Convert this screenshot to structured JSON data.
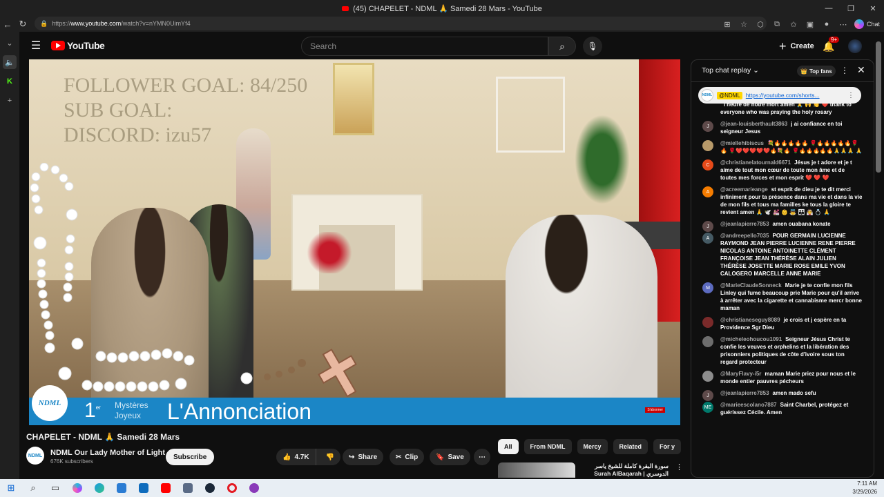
{
  "window": {
    "title": "(45) CHAPELET - NDML 🙏 Samedi 28 Mars - YouTube",
    "controls": [
      "—",
      "❐",
      "✕"
    ]
  },
  "browser": {
    "url_prefix": "https://",
    "url_host": "www.youtube.com",
    "url_path": "/watch?v=nYMN0UimYf4",
    "copilot_label": "Chat"
  },
  "header": {
    "search_placeholder": "Search",
    "create_label": "Create",
    "notif_count": "9+",
    "logo_text": "YouTube"
  },
  "video": {
    "overlay_lines": [
      "FOLLOWER GOAL:  84/250",
      "SUB GOAL:",
      "DISCORD: izu57"
    ],
    "logo": "NDML",
    "mystery_number": "1",
    "mystery_sup": "er",
    "mystery_label_1": "Mystères",
    "mystery_label_2": "Joyeux",
    "mystery_title": "L'Annonciation",
    "subscribe_tag": "S'abonner"
  },
  "below_video": {
    "title": "CHAPELET - NDML 🙏 Samedi 28 Mars",
    "channel_name": "NDML Our Lady Mother of Light",
    "channel_subs": "676K subscribers",
    "subscribe_label": "Subscribe",
    "channel_avatar": "NDML",
    "like_count": "4.7K",
    "share_label": "Share",
    "clip_label": "Clip",
    "save_label": "Save"
  },
  "chips": [
    "All",
    "From NDML",
    "Mercy",
    "Related",
    "For y"
  ],
  "recommendation": {
    "title": "سورة البقرة كاملة للشيخ ياسر الدوسري | Surah AlBaqarah"
  },
  "chat": {
    "header_title": "Top chat replay",
    "top_fans_label": "Top fans",
    "pinned": {
      "badge": "@NDML",
      "link": "https://youtube.com/shorts..."
    },
    "messages": [
      {
        "author": "",
        "text": "l'heure de notre mort amen 🙏 🙌 👏 ❤️ thank to everyone who was praying the holy rosary",
        "initial": "",
        "color": "#0f0f0f"
      },
      {
        "author": "@jean-louisberthault3863",
        "text": "j ai confiance en toi seigneur Jesus",
        "initial": "J",
        "color": "#5e4a4a"
      },
      {
        "author": "@miellehibiscus",
        "text": "💐🔥🔥🔥🔥🔥 🌹🔥🔥🔥🔥🔥🌹🔥 🌹❤️❤️❤️❤️❤️🔥💐🔥 🌹🔥🔥🔥🔥🔥🙏🙏🙏 🙏",
        "initial": "",
        "color": "#b89a6a"
      },
      {
        "author": "@christianelatournald6671",
        "text": "Jésus je t adore et je t aime de tout mon cœur de toute mon âme et de toutes mes forces et mon esprit ❤️ ❤️ ❤️",
        "initial": "C",
        "color": "#e64a19"
      },
      {
        "author": "@acreemarieange",
        "text": "st esprit de dieu je te dit merci infiniment pour ta présence dans ma vie et dans la vie de mon fils et tous ma familles ke tous la gloire te revient amen 🙏 🕊️ 💒 👶 👼 👪 👰 💍 🙏",
        "initial": "A",
        "color": "#f57c00"
      },
      {
        "author": "@jeanlapierre7853",
        "text": "amen ouabana konate",
        "initial": "J",
        "color": "#5e4a4a"
      },
      {
        "author": "@andreepello7035",
        "text": "POUR GERMAIN LUCIENNE RAYMOND JEAN PIERRE LUCIENNE RENE PIERRE NICOLAS ANTOINE ANTOINETTE CLÉMENT FRANÇOISE JEAN THÉRÈSE ALAIN JULIEN THÉRÈSE JOSETTE MARIE ROSE EMILE YVON CALOGERO MARCELLE ANNE MARIE",
        "initial": "A",
        "color": "#455a64"
      },
      {
        "author": "@MarieClaudeSonneck",
        "text": "Marie je te confie mon fils Linley qui fume beaucoup prie Marie pour qu'il arrive à arrêter avec la cigarette et cannabisme mercr bonne maman",
        "initial": "M",
        "color": "#5c6bc0"
      },
      {
        "author": "@christianeseguy8089",
        "text": "je crois et j espère en ta Providence Sgr Dieu",
        "initial": "",
        "color": "#7a2a2a"
      },
      {
        "author": "@micheleohoucou1091",
        "text": "Seigneur Jésus Christ te confie les veuves et orphelins et la libération des prisonniers politiques de côte d'ivoire sous ton regard protecteur",
        "initial": "",
        "color": "#6d6d6d"
      },
      {
        "author": "@MaryFlavy-i5r",
        "text": "maman Marie priez pour nous et le monde entier pauvres pécheurs",
        "initial": "",
        "color": "#8d8d8d"
      },
      {
        "author": "@jeanlapierre7853",
        "text": "amen mado sefu",
        "initial": "J",
        "color": "#5e4a4a"
      },
      {
        "author": "@marieescolano7887",
        "text": "Saint Charbel, protégez et guérissez Cécile. Amen",
        "initial": "ME",
        "color": "#00796b"
      }
    ]
  },
  "taskbar": {
    "time": "7:11 AM",
    "date": "3/29/2026"
  },
  "colors": {
    "yt_red": "#ff0000",
    "banner_blue": "#1b86c6",
    "bg": "#0f0f0f"
  }
}
